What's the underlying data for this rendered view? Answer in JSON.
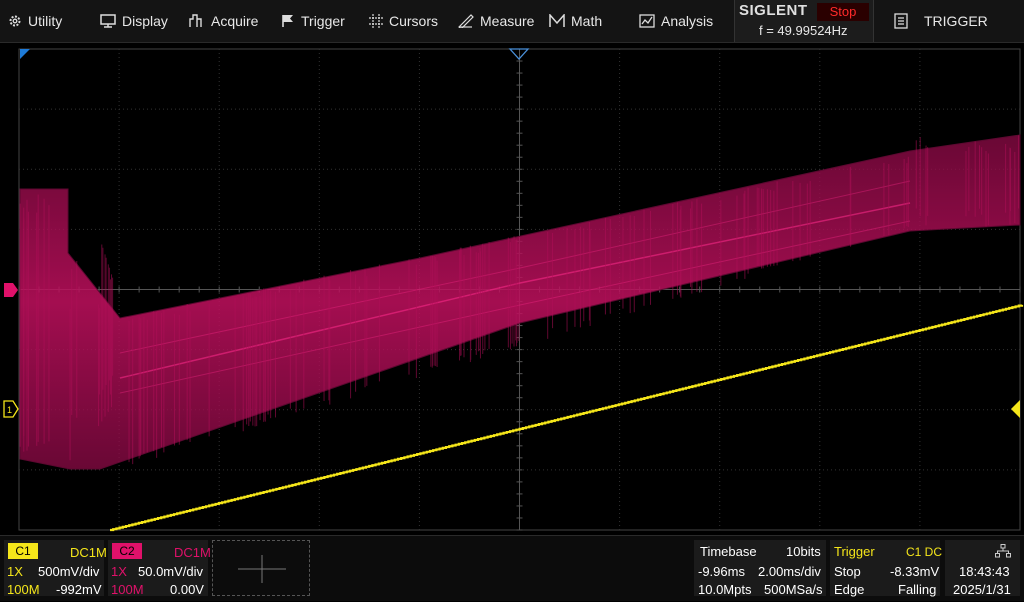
{
  "menu": [
    {
      "id": "utility",
      "label": "Utility",
      "icon": "gear-icon"
    },
    {
      "id": "display",
      "label": "Display",
      "icon": "monitor-icon"
    },
    {
      "id": "acquire",
      "label": "Acquire",
      "icon": "acquire-icon"
    },
    {
      "id": "trigger",
      "label": "Trigger",
      "icon": "flag-icon"
    },
    {
      "id": "cursors",
      "label": "Cursors",
      "icon": "crosshair-icon"
    },
    {
      "id": "measure",
      "label": "Measure",
      "icon": "ruler-icon"
    },
    {
      "id": "math",
      "label": "Math",
      "icon": "math-icon"
    },
    {
      "id": "analysis",
      "label": "Analysis",
      "icon": "analysis-icon"
    }
  ],
  "brand": {
    "name": "SIGLENT",
    "run_state": "Stop",
    "frequency": "f = 49.99524Hz"
  },
  "right_menu": {
    "label": "TRIGGER",
    "icon": "list-icon"
  },
  "colors": {
    "ch1": "#f5e61a",
    "ch2": "#e0116a",
    "grid": "#3a3a3a",
    "trigger_marker": "#1e7bd8"
  },
  "ch1": {
    "tag": "C1",
    "coupling": "DC1M",
    "probe": "1X",
    "scale": "500mV/div",
    "bw": "100M",
    "offset": "-992mV"
  },
  "ch2": {
    "tag": "C2",
    "coupling": "DC1M",
    "probe": "1X",
    "scale": "50.0mV/div",
    "bw": "100M",
    "offset": "0.00V"
  },
  "timebase": {
    "title": "Timebase",
    "bits": "10bits",
    "delay": "-9.96ms",
    "scale": "2.00ms/div",
    "points": "10.0Mpts",
    "rate": "500MSa/s"
  },
  "trigger": {
    "title": "Trigger",
    "source": "C1 DC",
    "mode": "Stop",
    "level": "-8.33mV",
    "type": "Edge",
    "slope": "Falling"
  },
  "clock": {
    "time": "18:43:43",
    "date": "2025/1/31",
    "icon": "network-icon"
  }
}
